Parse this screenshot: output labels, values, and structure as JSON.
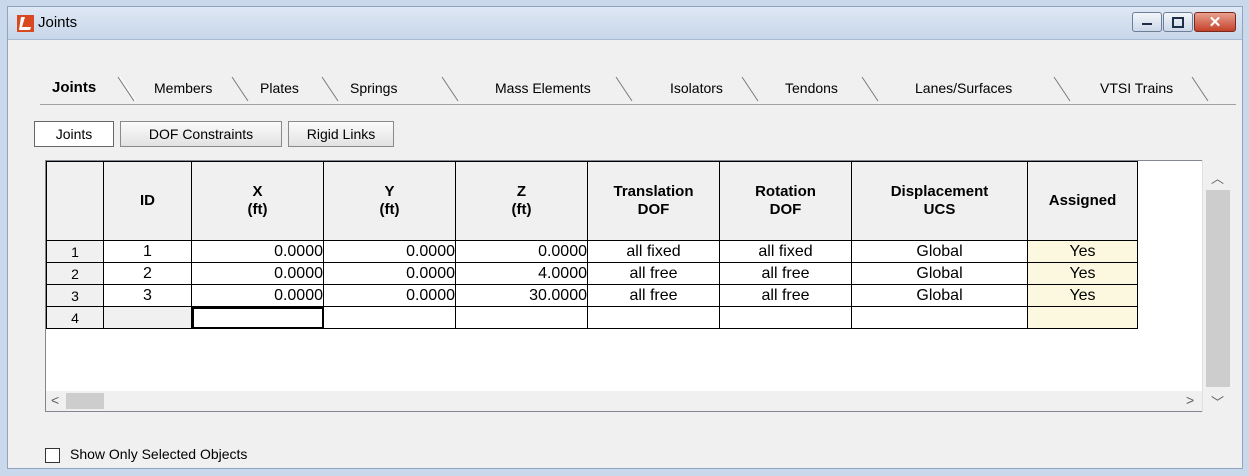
{
  "window": {
    "title": "Joints",
    "accent": "#c84a1e",
    "controls": {
      "minimize": "minimize-icon",
      "maximize": "maximize-icon",
      "close": "✕"
    }
  },
  "tabs": [
    {
      "label": "Joints",
      "active": true
    },
    {
      "label": "Members",
      "active": false
    },
    {
      "label": "Plates",
      "active": false
    },
    {
      "label": "Springs",
      "active": false
    },
    {
      "label": "Mass Elements",
      "active": false
    },
    {
      "label": "Isolators",
      "active": false
    },
    {
      "label": "Tendons",
      "active": false
    },
    {
      "label": "Lanes/Surfaces",
      "active": false
    },
    {
      "label": "VTSI Trains",
      "active": false
    }
  ],
  "subtabs": [
    {
      "label": "Joints",
      "active": true
    },
    {
      "label": "DOF Constraints",
      "active": false
    },
    {
      "label": "Rigid Links",
      "active": false
    }
  ],
  "table": {
    "columns": [
      {
        "line1": "ID",
        "line2": ""
      },
      {
        "line1": "X",
        "line2": "(ft)"
      },
      {
        "line1": "Y",
        "line2": "(ft)"
      },
      {
        "line1": "Z",
        "line2": "(ft)"
      },
      {
        "line1": "Translation",
        "line2": "DOF"
      },
      {
        "line1": "Rotation",
        "line2": "DOF"
      },
      {
        "line1": "Displacement",
        "line2": "UCS"
      },
      {
        "line1": "Assigned",
        "line2": ""
      }
    ],
    "rows": [
      {
        "num": "1",
        "id": "1",
        "x": "0.0000",
        "y": "0.0000",
        "z": "0.0000",
        "tdof": "all fixed",
        "rdof": "all fixed",
        "ucs": "Global",
        "assigned": "Yes"
      },
      {
        "num": "2",
        "id": "2",
        "x": "0.0000",
        "y": "0.0000",
        "z": "4.0000",
        "tdof": "all free",
        "rdof": "all free",
        "ucs": "Global",
        "assigned": "Yes"
      },
      {
        "num": "3",
        "id": "3",
        "x": "0.0000",
        "y": "0.0000",
        "z": "30.0000",
        "tdof": "all free",
        "rdof": "all free",
        "ucs": "Global",
        "assigned": "Yes"
      },
      {
        "num": "4",
        "id": "",
        "x": "",
        "y": "",
        "z": "",
        "tdof": "",
        "rdof": "",
        "ucs": "",
        "assigned": ""
      }
    ],
    "assigned_color": "#fcf8e0"
  },
  "footer": {
    "show_selected_label": "Show Only Selected Objects",
    "show_selected_checked": false
  }
}
